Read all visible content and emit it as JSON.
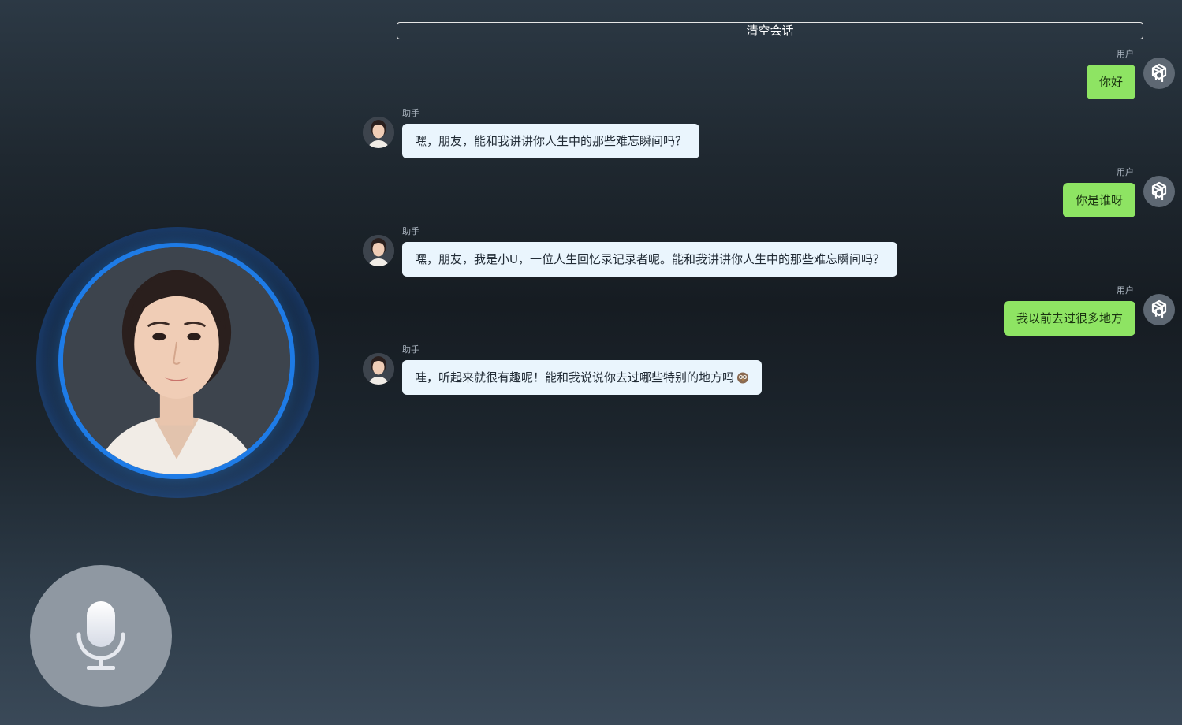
{
  "toolbar": {
    "clear_label": "清空会话"
  },
  "colors": {
    "user_bubble": "#8ee463",
    "assistant_bubble": "#eaf5fd",
    "ring": "#1e7be6",
    "mic_button": "#8f98a2"
  },
  "icons": {
    "user_avatar": "openai-logo-icon",
    "mic": "microphone-icon",
    "emoji": "owl-emoji-icon"
  },
  "messages": [
    {
      "role": "user",
      "label": "用户",
      "text": "你好"
    },
    {
      "role": "assistant",
      "label": "助手",
      "text": "嘿，朋友，能和我讲讲你人生中的那些难忘瞬间吗？"
    },
    {
      "role": "user",
      "label": "用户",
      "text": "你是谁呀"
    },
    {
      "role": "assistant",
      "label": "助手",
      "text": "嘿，朋友，我是小U，一位人生回忆录记录者呢。能和我讲讲你人生中的那些难忘瞬间吗？"
    },
    {
      "role": "user",
      "label": "用户",
      "text": "我以前去过很多地方"
    },
    {
      "role": "assistant",
      "label": "助手",
      "text": "哇，听起来就很有趣呢！能和我说说你去过哪些特别的地方吗"
    }
  ]
}
